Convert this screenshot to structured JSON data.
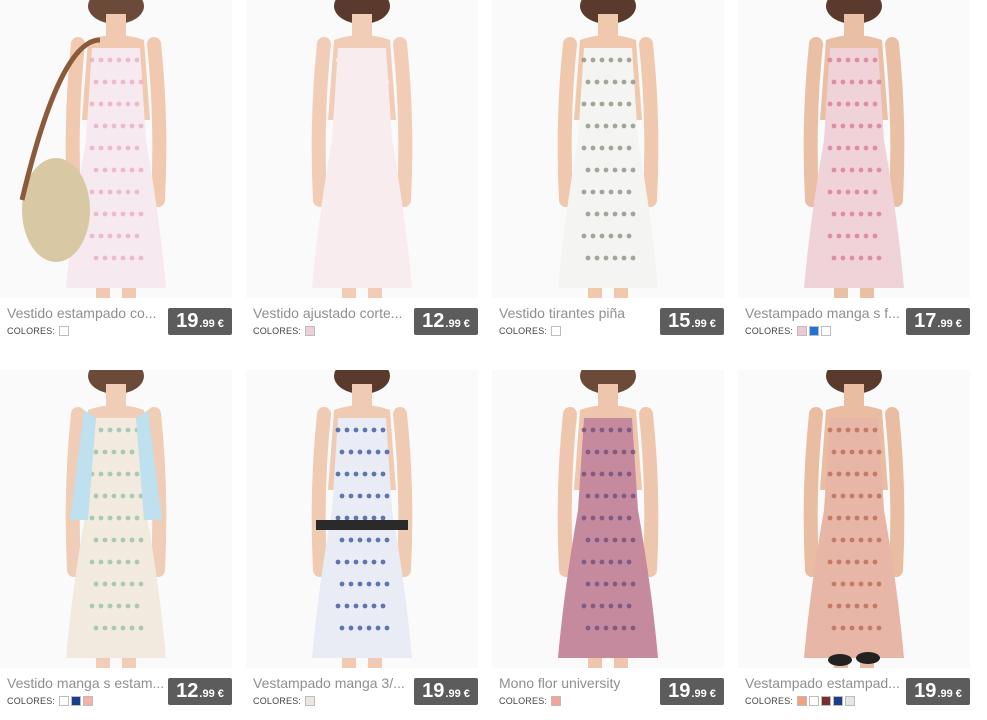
{
  "products": [
    {
      "title": "Vestido estampado co...",
      "price_int": "19",
      "price_dec": ".99",
      "currency": "€",
      "colors_label": "COLORES:",
      "swatches": [
        "#ffffff"
      ],
      "skin": "#f0c9b0",
      "dress": "#f6e9ef",
      "pattern": "#e9a9bd",
      "hair": "#6b4a3a",
      "extra": "bag"
    },
    {
      "title": "Vestido ajustado corte...",
      "price_int": "12",
      "price_dec": ".99",
      "currency": "€",
      "colors_label": "COLORES:",
      "swatches": [
        "#efcfd6"
      ],
      "skin": "#f1cdb7",
      "dress": "#f8ecee",
      "pattern": "#f8ecee",
      "hair": "#5a3a2c",
      "extra": "none"
    },
    {
      "title": "Vestido tirantes piña",
      "price_int": "15",
      "price_dec": ".99",
      "currency": "€",
      "colors_label": "COLORES:",
      "swatches": [
        "#ffffff"
      ],
      "skin": "#efc8ad",
      "dress": "#f4f4f2",
      "pattern": "#8a8a7a",
      "hair": "#5a3a2c",
      "extra": "none"
    },
    {
      "title": "Vestampado manga s f...",
      "price_int": "17",
      "price_dec": ".99",
      "currency": "€",
      "colors_label": "COLORES:",
      "swatches": [
        "#f0c8d2",
        "#1e73d8",
        "#ffffff"
      ],
      "skin": "#e9c0a6",
      "dress": "#efd3d9",
      "pattern": "#d9758e",
      "hair": "#5a3a2c",
      "extra": "none"
    },
    {
      "title": "Vestido manga s estam...",
      "price_int": "12",
      "price_dec": ".99",
      "currency": "€",
      "colors_label": "COLORES:",
      "swatches": [
        "#ffffff",
        "#1a3f8a",
        "#f6b1ad"
      ],
      "skin": "#f0cdb6",
      "dress": "#f3eadf",
      "pattern": "#8fbfa4",
      "hair": "#6b4a3a",
      "extra": "jacket"
    },
    {
      "title": "Vestampado manga 3/...",
      "price_int": "19",
      "price_dec": ".99",
      "currency": "€",
      "colors_label": "COLORES:",
      "swatches": [
        "#efe7df"
      ],
      "skin": "#f0cbb3",
      "dress": "#e9ecf4",
      "pattern": "#2f4d99",
      "hair": "#5a3a2c",
      "extra": "belt"
    },
    {
      "title": "Mono flor university",
      "price_int": "19",
      "price_dec": ".99",
      "currency": "€",
      "colors_label": "COLORES:",
      "swatches": [
        "#f4a49a"
      ],
      "skin": "#eec6ad",
      "dress": "#c68a9e",
      "pattern": "#6a4b7a",
      "hair": "#6b4a3a",
      "extra": "none"
    },
    {
      "title": "Vestampado estampad...",
      "price_int": "19",
      "price_dec": ".99",
      "currency": "€",
      "colors_label": "COLORES:",
      "swatches": [
        "#f4a07a",
        "#ffffff",
        "#7a2e2a",
        "#1a3f8a",
        "#e6e6e6"
      ],
      "skin": "#e9bda1",
      "dress": "#e7b6a6",
      "pattern": "#b8654f",
      "hair": "#5a3a2c",
      "extra": "shoes"
    }
  ]
}
